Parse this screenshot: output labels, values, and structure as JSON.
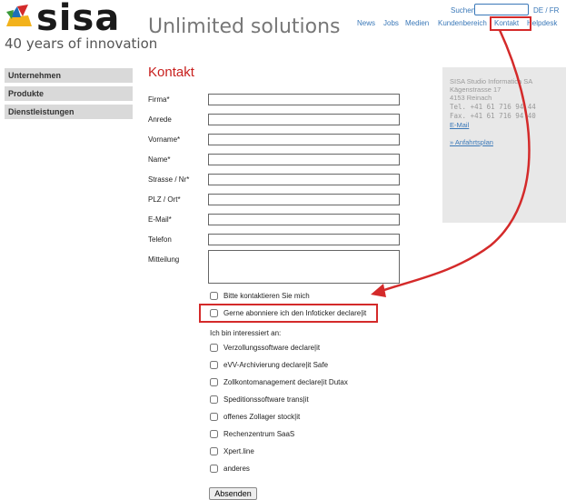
{
  "brand": {
    "logo_text": "sisa",
    "tagline": "40 years of innovation",
    "slogan": "Unlimited solutions"
  },
  "topbar": {
    "search_label": "Suchen",
    "search_value": "",
    "language_switch": "DE / FR",
    "nav": [
      "News",
      "Jobs",
      "Medien",
      "Kundenbereich",
      "Kontakt",
      "Helpdesk"
    ]
  },
  "sidebar": {
    "items": [
      {
        "label": "Unternehmen"
      },
      {
        "label": "Produkte"
      },
      {
        "label": "Dienstleistungen"
      }
    ]
  },
  "form": {
    "title": "Kontakt",
    "fields": [
      {
        "label": "Firma*",
        "value": ""
      },
      {
        "label": "Anrede",
        "value": ""
      },
      {
        "label": "Vorname*",
        "value": ""
      },
      {
        "label": "Name*",
        "value": ""
      },
      {
        "label": "Strasse / Nr*",
        "value": ""
      },
      {
        "label": "PLZ / Ort*",
        "value": ""
      },
      {
        "label": "E-Mail*",
        "value": ""
      },
      {
        "label": "Telefon",
        "value": ""
      }
    ],
    "message_label": "Mitteilung",
    "message_value": "",
    "contact_me": {
      "label": "Bitte kontaktieren Sie mich",
      "checked": false
    },
    "newsletter": {
      "label": "Gerne abonniere ich den Infoticker declare|it",
      "checked": false
    },
    "interest_heading": "Ich bin interessiert an:",
    "interests": [
      {
        "label": "Verzollungssoftware declare|it",
        "checked": false
      },
      {
        "label": "eVV-Archivierung declare|it Safe",
        "checked": false
      },
      {
        "label": "Zollkontomanagement declare|it Dutax",
        "checked": false
      },
      {
        "label": "Speditionssoftware trans|it",
        "checked": false
      },
      {
        "label": "offenes Zollager stock|it",
        "checked": false
      },
      {
        "label": "Rechenzentrum SaaS",
        "checked": false
      },
      {
        "label": "Xpert.line",
        "checked": false
      },
      {
        "label": "anderes",
        "checked": false
      }
    ],
    "submit_label": "Absenden"
  },
  "contact_info": {
    "lines": [
      "SISA Studio Informatica SA",
      "Kägenstrasse 17",
      "4153 Reinach",
      "Tel.  +41 61 716 94 44",
      "Fax.  +41 61 716 94 40"
    ],
    "email_link": "E-Mail",
    "map_link": "» Anfahrtsplan"
  },
  "colors": {
    "accent_red": "#c8201e",
    "link_blue": "#3a78b8",
    "annotation_red": "#d42a2a",
    "sidebar_bg": "#d9d9d9",
    "panel_bg": "#e8e8e8"
  }
}
